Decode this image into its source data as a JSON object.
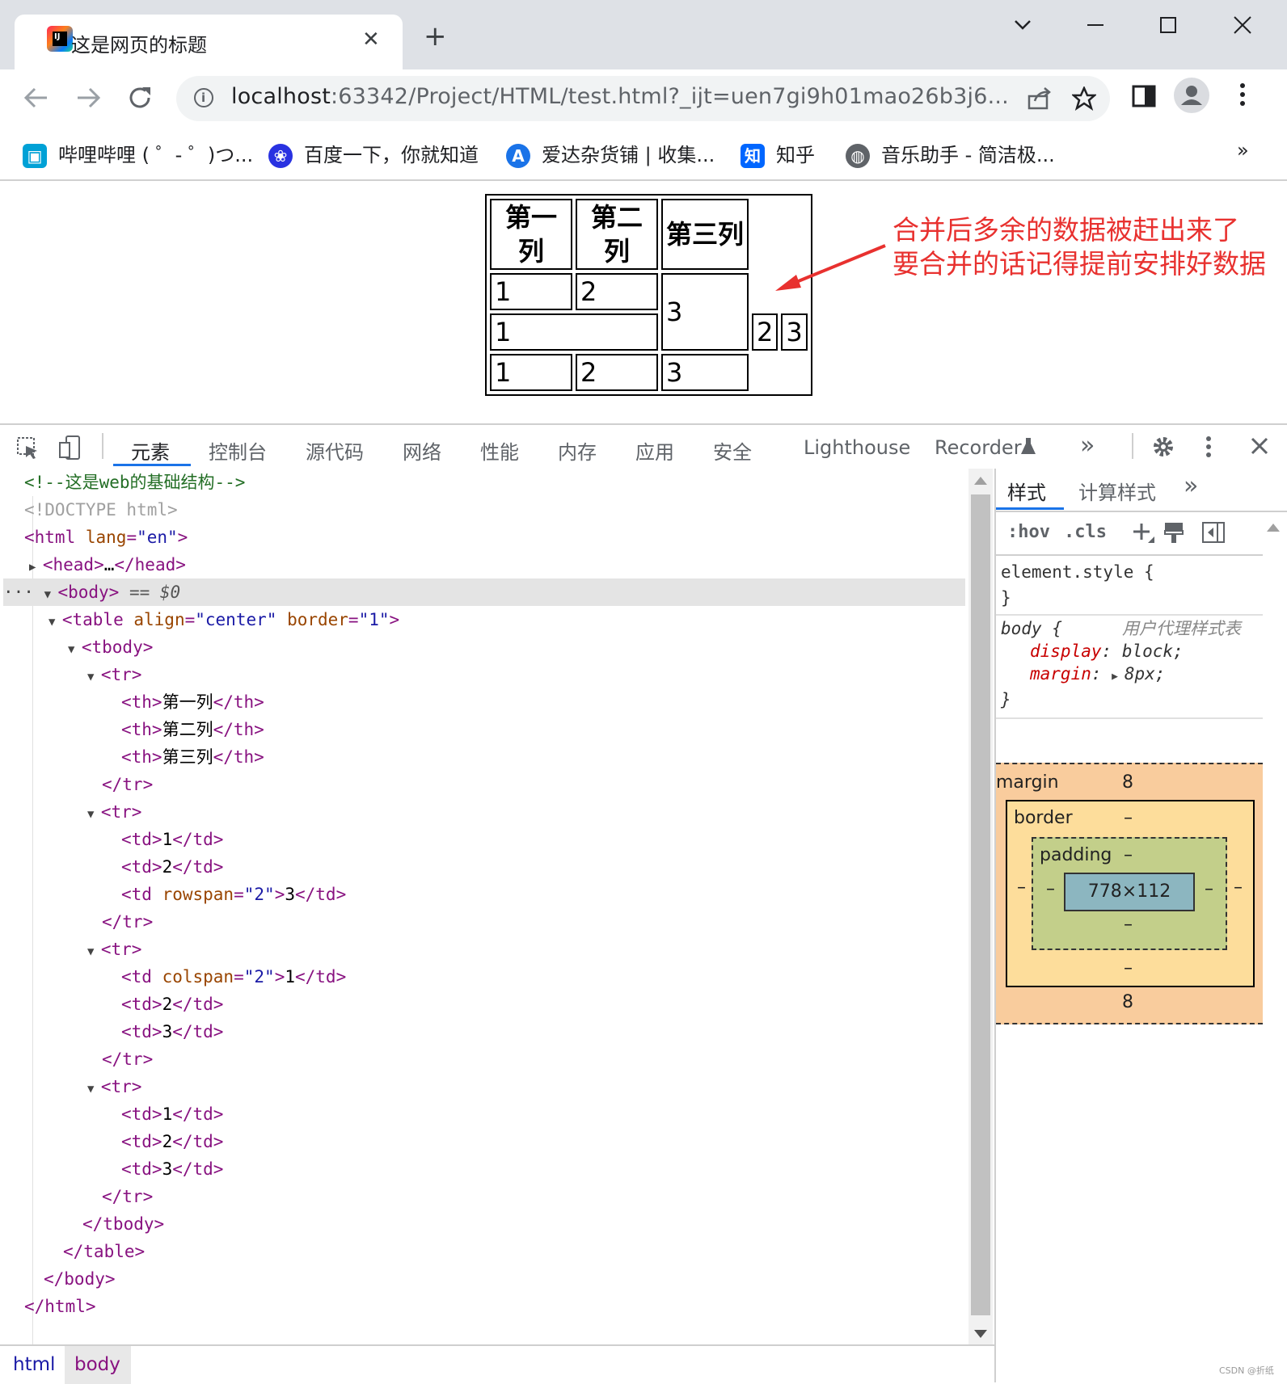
{
  "browser": {
    "tab_title": "这是网页的标题",
    "tab_close": "✕",
    "new_tab": "+",
    "url_host": "localhost",
    "url_rest": ":63342/Project/HTML/test.html?_ijt=uen7gi9h01mao26b3j6...",
    "favicon_text": "IJ",
    "bookmarks": [
      {
        "label": "哔哩哔哩 ( ゜- ゜)つ...",
        "icon": "bilibili-icon",
        "color": "#00a1d6"
      },
      {
        "label": "百度一下，你就知道",
        "icon": "baidu-paw-icon",
        "color": "#2932e1"
      },
      {
        "label": "爱达杂货铺 | 收集...",
        "icon": "letter-a-icon",
        "color": "#1a73e8"
      },
      {
        "label": "知乎",
        "icon": "zhihu-icon",
        "color": "#0066ff"
      },
      {
        "label": "音乐助手 - 简洁极...",
        "icon": "globe-icon",
        "color": "#5f6368"
      }
    ],
    "bookmarks_more": "»"
  },
  "page": {
    "table": {
      "headers": [
        "第一列",
        "第二列",
        "第三列"
      ],
      "rows": [
        [
          "1",
          "2",
          "3"
        ],
        [
          "1",
          "2",
          "3"
        ],
        [
          "1",
          "2",
          "3"
        ]
      ]
    },
    "annotation": [
      "合并后多余的数据被赶出来了",
      "要合并的话记得提前安排好数据"
    ],
    "annotation_color": "#e8312f"
  },
  "devtools": {
    "tabs": [
      "元素",
      "控制台",
      "源代码",
      "网络",
      "性能",
      "内存",
      "应用",
      "安全",
      "Lighthouse",
      "Recorder"
    ],
    "active_tab": "元素",
    "more": "»",
    "breadcrumbs": [
      "html",
      "body"
    ],
    "dom": {
      "comment": "<!--这是web的基础结构-->",
      "doctype": "<!DOCTYPE html>",
      "th": [
        "第一列",
        "第二列",
        "第三列"
      ],
      "lang": "\"en\"",
      "align": "\"center\"",
      "border": "\"1\"",
      "span": "\"2\"",
      "dollar": "== $0"
    },
    "side_tabs": [
      "样式",
      "计算样式"
    ],
    "hov": ":hov",
    "cls": ".cls",
    "element_style": "element.style {",
    "body_rule": "body {",
    "ua_label": "用户代理样式表",
    "decl_display_prop": "display",
    "decl_display_val": "block;",
    "decl_margin_prop": "margin",
    "decl_margin_val": "8px;",
    "close_brace": "}",
    "box": {
      "margin_label": "margin",
      "margin_top": "8",
      "margin_bottom": "8",
      "border_label": "border",
      "padding_label": "padding",
      "dash": "–",
      "content": "778×112"
    },
    "watermark": "CSDN @折纸"
  }
}
